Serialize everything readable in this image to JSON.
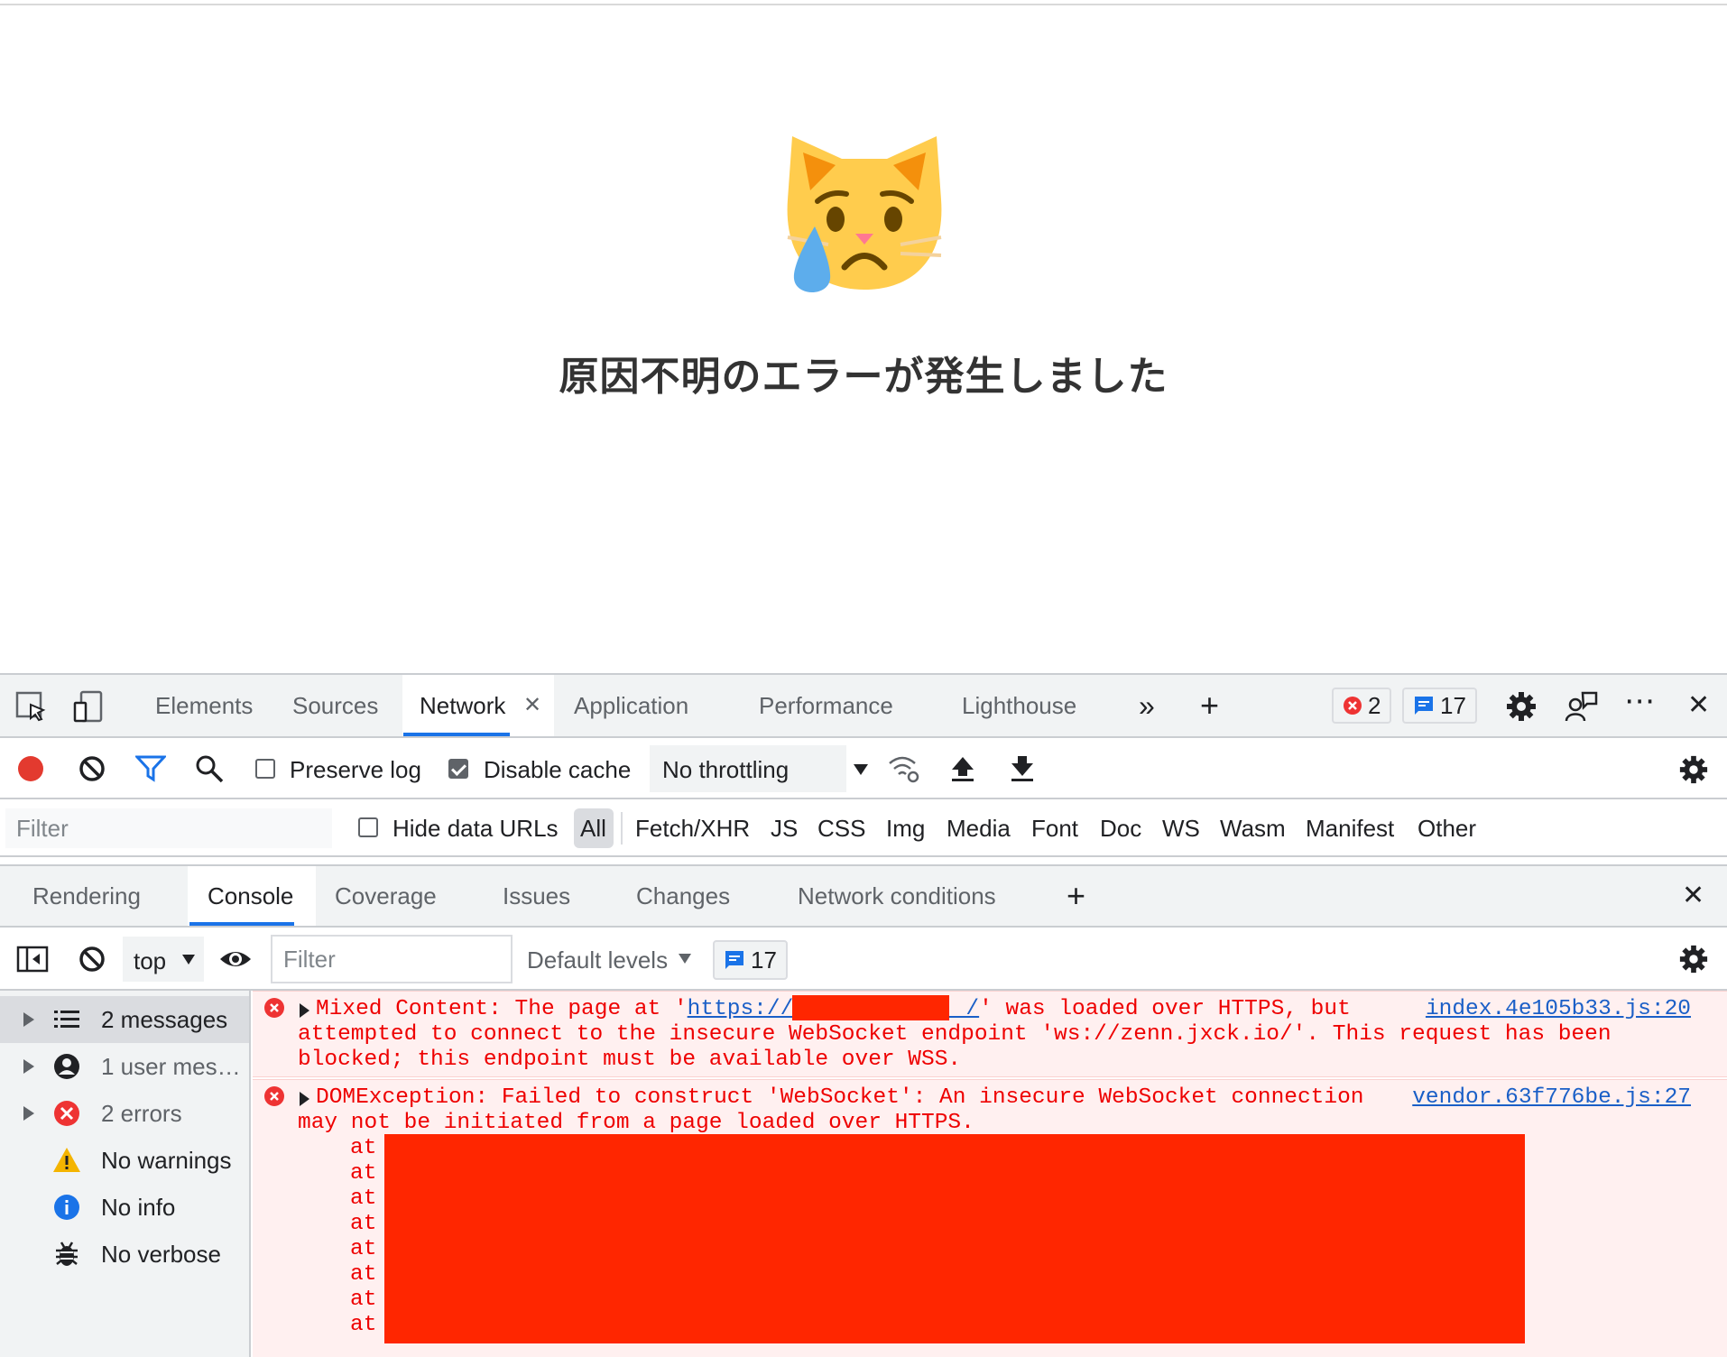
{
  "page": {
    "error_message": "原因不明のエラーが発生しました"
  },
  "devtools": {
    "main_tabs": [
      {
        "label": "Elements"
      },
      {
        "label": "Sources"
      },
      {
        "label": "Network",
        "active": true
      },
      {
        "label": "Application"
      },
      {
        "label": "Performance"
      },
      {
        "label": "Lighthouse"
      }
    ],
    "error_count": "2",
    "message_count": "17",
    "network_toolbar": {
      "preserve_log": "Preserve log",
      "disable_cache": "Disable cache",
      "throttling": "No throttling"
    },
    "filter_bar": {
      "filter_placeholder": "Filter",
      "hide_data_urls": "Hide data URLs",
      "types": [
        "All",
        "Fetch/XHR",
        "JS",
        "CSS",
        "Img",
        "Media",
        "Font",
        "Doc",
        "WS",
        "Wasm",
        "Manifest",
        "Other"
      ]
    },
    "drawer_tabs": [
      {
        "label": "Rendering"
      },
      {
        "label": "Console",
        "active": true
      },
      {
        "label": "Coverage"
      },
      {
        "label": "Issues"
      },
      {
        "label": "Changes"
      },
      {
        "label": "Network conditions"
      }
    ],
    "console_toolbar": {
      "context": "top",
      "filter_placeholder": "Filter",
      "levels": "Default levels",
      "message_count": "17"
    },
    "sidebar": [
      {
        "label": "2 messages",
        "icon": "list-icon"
      },
      {
        "label": "1 user mes…",
        "icon": "user-icon"
      },
      {
        "label": "2 errors",
        "icon": "error-icon"
      },
      {
        "label": "No warnings",
        "icon": "warning-icon"
      },
      {
        "label": "No info",
        "icon": "info-icon"
      },
      {
        "label": "No verbose",
        "icon": "bug-icon"
      }
    ],
    "messages": [
      {
        "line1_prefix": "Mixed Content: The page at '",
        "line1_link": "https://             /",
        "line1_suffix": "' was loaded over HTTPS, but",
        "line2": "attempted to connect to the insecure WebSocket endpoint 'ws://zenn.jxck.io/'. This request has been",
        "line3": "blocked; this endpoint must be available over WSS.",
        "source": "index.4e105b33.js:20"
      },
      {
        "line1": "DOMException: Failed to construct 'WebSocket': An insecure WebSocket connection",
        "line2": "may not be initiated from a page loaded over HTTPS.",
        "stack": [
          "at",
          "at",
          "at",
          "at",
          "at",
          "at",
          "at",
          "at"
        ],
        "source": "vendor.63f776be.js:27"
      }
    ]
  }
}
